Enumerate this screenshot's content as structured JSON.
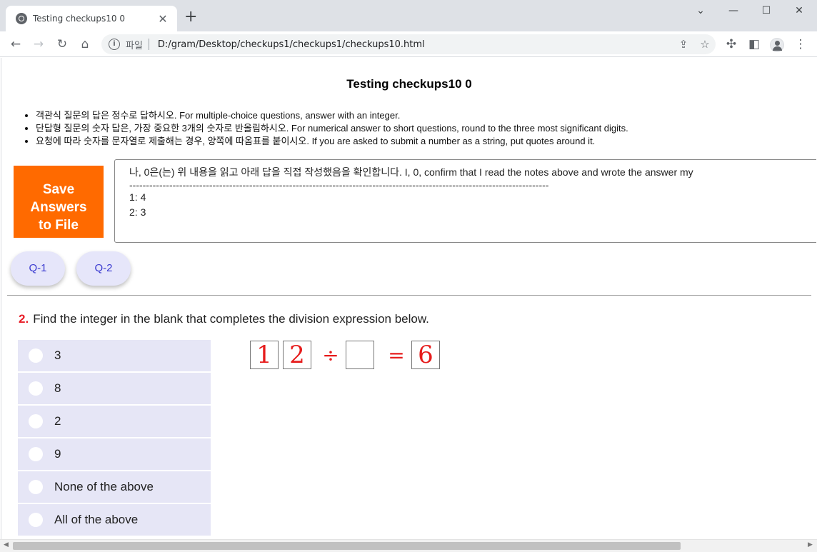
{
  "browser": {
    "tab_title": "Testing checkups10 0",
    "tab_close": "✕",
    "new_tab": "+",
    "scheme_label": "파일",
    "url": "D:/gram/Desktop/checkups1/checkups1/checkups10.html",
    "win_minimize": "⌄",
    "win_min": "—",
    "win_max": "☐",
    "win_close": "✕"
  },
  "page": {
    "title": "Testing checkups10 0",
    "rules": [
      "객관식 질문의 답은 정수로 답하시오. For multiple-choice questions, answer with an integer.",
      "단답형 질문의 숫자 답은, 가장 중요한 3개의 숫자로 반올림하시오. For numerical answer to short questions, round to the three most significant digits.",
      "요청에 따라 숫자를 문자열로 제출해는 경우, 양쪽에 따옴표를 붙이시오. If you are asked to submit a number as a string, put quotes around it."
    ],
    "save_button": "Save\nAnswers\nto File",
    "answer_box": {
      "confirm": "나, 0은(는) 위 내용을 읽고 아래 답을 직접 작성했음을 확인합니다. I, 0, confirm that I read the notes above and wrote the answer my",
      "divider": "------------------------------------------------------------------------------------------------------------------------------",
      "answers": [
        "1: 4",
        "2: 3"
      ]
    },
    "nav_buttons": [
      "Q-1",
      "Q-2"
    ]
  },
  "question": {
    "number": "2.",
    "text": "Find the integer in the blank that completes the division expression below.",
    "options": [
      "3",
      "8",
      "2",
      "9",
      "None of the above",
      "All of the above"
    ],
    "expression": {
      "digits": [
        "1",
        "2"
      ],
      "divide_sign": "÷",
      "equals_sign": "=",
      "result": "6"
    }
  },
  "colors": {
    "save_button": "#ff6a00",
    "nav_button_bg": "#e6e6fa",
    "option_bg": "#e6e6f6",
    "question_number": "#e8202a",
    "expression": "#e61c1c"
  }
}
